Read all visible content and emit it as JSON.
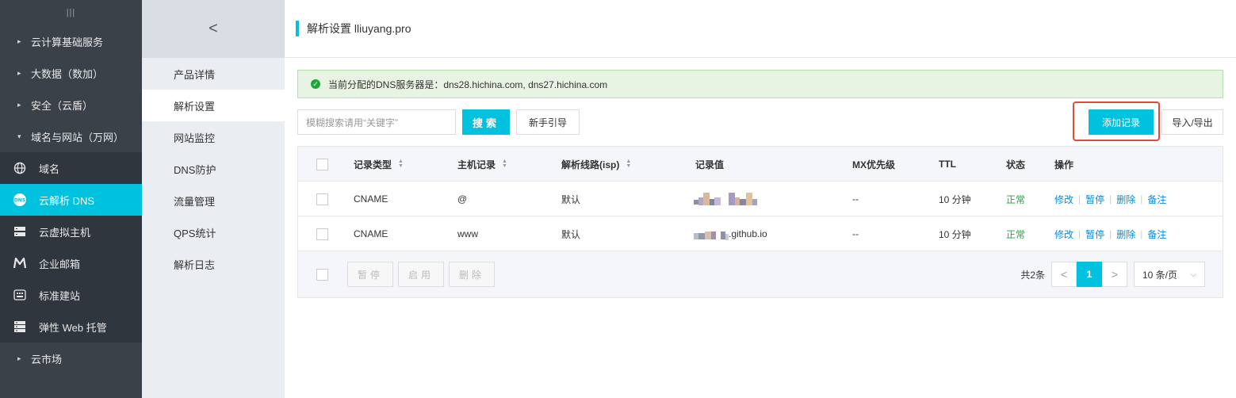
{
  "sidebar": {
    "grip": "|||",
    "groups": [
      {
        "label": "云计算基础服务"
      },
      {
        "label": "大数据（数加）"
      },
      {
        "label": "安全（云盾）"
      },
      {
        "label": "域名与网站（万网）"
      }
    ],
    "items": [
      {
        "label": "域名",
        "icon": "globe-icon"
      },
      {
        "label": "云解析 DNS",
        "icon": "dns-icon"
      },
      {
        "label": "云虚拟主机",
        "icon": "server-icon"
      },
      {
        "label": "企业邮箱",
        "icon": "mail-m-icon"
      },
      {
        "label": "标准建站",
        "icon": "keyboard-icon"
      },
      {
        "label": "弹性 Web 托管",
        "icon": "server-stack-icon"
      }
    ],
    "market": "云市场"
  },
  "subnav": {
    "back": "<",
    "items": [
      "产品详情",
      "解析设置",
      "网站监控",
      "DNS防护",
      "流量管理",
      "QPS统计",
      "解析日志"
    ]
  },
  "header": {
    "title": "解析设置 lliuyang.pro"
  },
  "notice": {
    "text": "当前分配的DNS服务器是：dns28.hichina.com, dns27.hichina.com"
  },
  "toolbar": {
    "search_placeholder": "模糊搜索请用“关键字”",
    "search_btn": "搜索",
    "guide_btn": "新手引导",
    "add_btn": "添加记录",
    "io_btn": "导入/导出"
  },
  "table": {
    "headers": [
      "记录类型",
      "主机记录",
      "解析线路(isp)",
      "记录值",
      "MX优先级",
      "TTL",
      "状态",
      "操作"
    ],
    "rows": [
      {
        "type": "CNAME",
        "host": "@",
        "line": "默认",
        "value_suffix": "",
        "mx": "--",
        "ttl": "10 分钟",
        "status": "正常"
      },
      {
        "type": "CNAME",
        "host": "www",
        "line": "默认",
        "value_suffix": ".github.io",
        "mx": "--",
        "ttl": "10 分钟",
        "status": "正常"
      }
    ],
    "ops": [
      "修改",
      "暂停",
      "删除",
      "备注"
    ],
    "footer_btns": [
      "暂停",
      "启用",
      "删除"
    ]
  },
  "pager": {
    "total": "共2条",
    "prev": "<",
    "current": "1",
    "next": ">",
    "size": "10 条/页"
  },
  "colors": {
    "accent": "#00c1de",
    "success": "#1fa739",
    "link": "#0a8ad8",
    "highlight": "#e04b3c"
  }
}
